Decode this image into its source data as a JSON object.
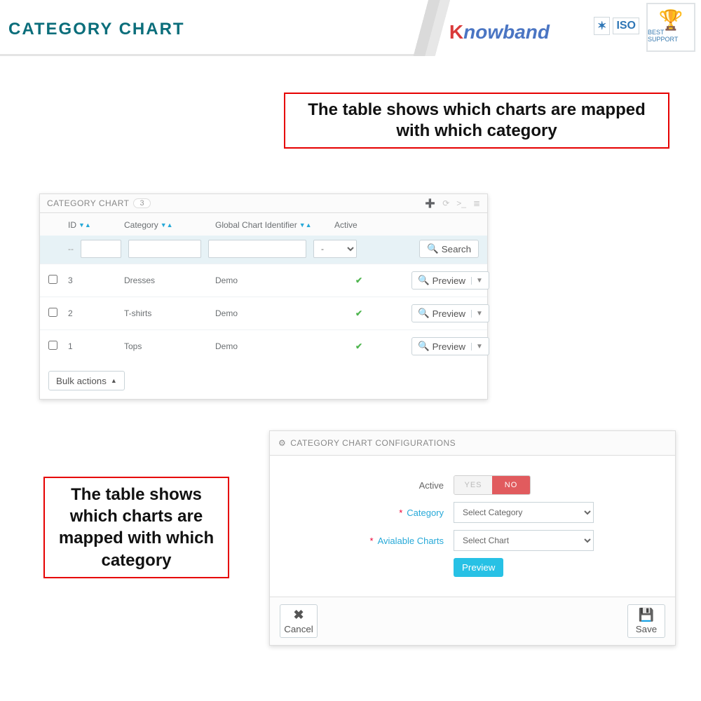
{
  "header": {
    "title": "CATEGORY CHART",
    "knowband_red": "K",
    "knowband_rest": "nowband",
    "iso": "ISO",
    "best_support": "BEST SUPPORT"
  },
  "callout1": "The table shows which charts are mapped with which category",
  "callout2": "The table shows which charts are mapped with which category",
  "listing": {
    "title": "CATEGORY CHART",
    "count": "3",
    "columns": {
      "id": "ID",
      "category": "Category",
      "gci": "Global Chart Identifier",
      "active": "Active"
    },
    "filter": {
      "dashes": "--",
      "select_placeholder": "-",
      "search": "Search"
    },
    "rows": [
      {
        "id": "3",
        "category": "Dresses",
        "gci": "Demo",
        "active": true,
        "btn": "Preview"
      },
      {
        "id": "2",
        "category": "T-shirts",
        "gci": "Demo",
        "active": true,
        "btn": "Preview"
      },
      {
        "id": "1",
        "category": "Tops",
        "gci": "Demo",
        "active": true,
        "btn": "Preview"
      }
    ],
    "bulk": "Bulk actions"
  },
  "config": {
    "title": "CATEGORY CHART CONFIGURATIONS",
    "active_label": "Active",
    "yes": "YES",
    "no": "NO",
    "category_label": "Category",
    "charts_label": "Avialable Charts",
    "select_category": "Select Category",
    "select_chart": "Select Chart",
    "preview": "Preview",
    "cancel": "Cancel",
    "save": "Save"
  }
}
